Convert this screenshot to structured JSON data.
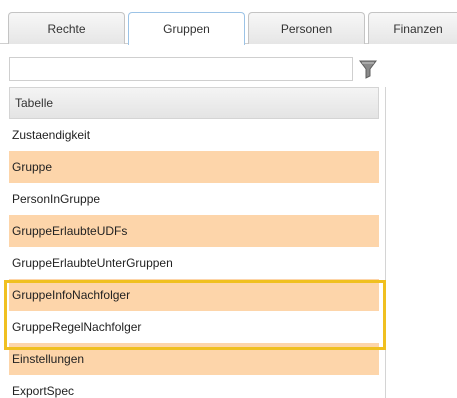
{
  "tabs": [
    {
      "label": "Rechte",
      "active": false
    },
    {
      "label": "Gruppen",
      "active": true
    },
    {
      "label": "Personen",
      "active": false
    },
    {
      "label": "Finanzen",
      "active": false
    }
  ],
  "filter": {
    "value": "",
    "placeholder": "",
    "icon": "funnel-filter-icon"
  },
  "table": {
    "column_header": "Tabelle",
    "rows": [
      "Zustaendigkeit",
      "Gruppe",
      "PersonInGruppe",
      "GruppeErlaubteUDFs",
      "GruppeErlaubteUnterGruppen",
      "GruppeInfoNachfolger",
      "GruppeRegelNachfolger",
      "Einstellungen",
      "ExportSpec"
    ],
    "row_stripe_color": "#fdd5aa"
  },
  "highlight": {
    "color": "#f0c020",
    "rows": [
      "GruppeInfoNachfolger",
      "GruppeRegelNachfolger"
    ]
  }
}
